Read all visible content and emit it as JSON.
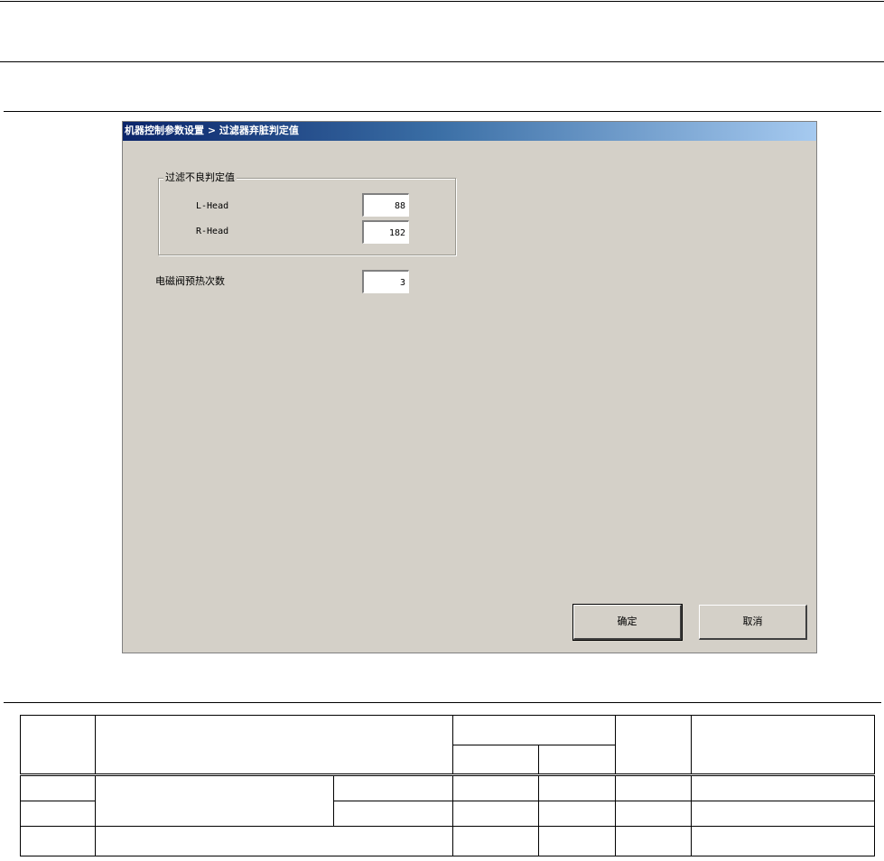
{
  "dialog": {
    "title": "机器控制参数设置 > 过滤器弃脏判定值",
    "group": {
      "label": "过滤不良判定值",
      "rows": [
        {
          "label": "L-Head",
          "value": "88"
        },
        {
          "label": "R-Head",
          "value": "182"
        }
      ]
    },
    "solenoid": {
      "label": "电磁阀预热次数",
      "value": "3"
    },
    "buttons": {
      "ok": "确定",
      "cancel": "取消"
    }
  }
}
